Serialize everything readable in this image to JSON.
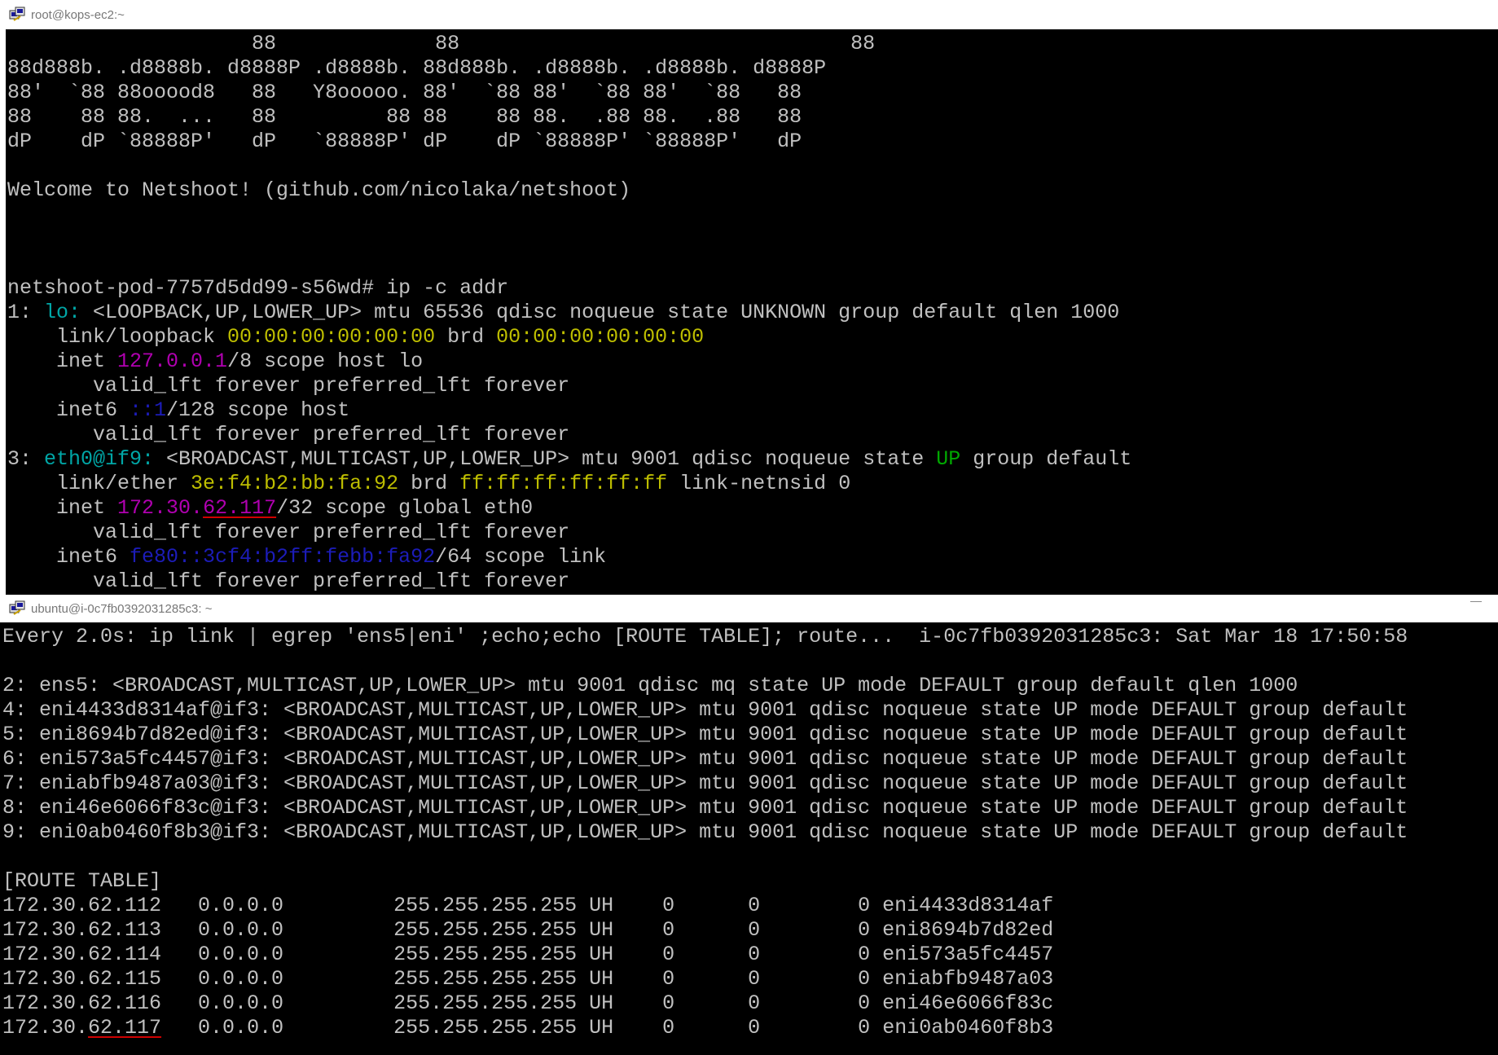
{
  "windows": {
    "top": {
      "title": "root@kops-ec2:~",
      "lines": [
        [
          {
            "t": "                    88             88                                88"
          }
        ],
        [
          {
            "t": "88d888b. .d8888b. d8888P .d8888b. 88d888b. .d8888b. .d8888b. d8888P"
          }
        ],
        [
          {
            "t": "88'  `88 88ooood8   88   Y8ooooo. 88'  `88 88'  `88 88'  `88   88"
          }
        ],
        [
          {
            "t": "88    88 88.  ...   88         88 88    88 88.  .88 88.  .88   88"
          }
        ],
        [
          {
            "t": "dP    dP `88888P'   dP   `88888P' dP    dP `88888P' `88888P'   dP"
          }
        ],
        [
          {
            "t": ""
          }
        ],
        [
          {
            "t": "Welcome to Netshoot! (github.com/nicolaka/netshoot)"
          }
        ],
        [
          {
            "t": ""
          }
        ],
        [
          {
            "t": ""
          }
        ],
        [
          {
            "t": ""
          }
        ],
        [
          {
            "t": "netshoot-pod-7757d5dd99-s56wd# ip -c addr"
          }
        ],
        [
          {
            "t": "1: "
          },
          {
            "t": "lo:",
            "c": "cyan"
          },
          {
            "t": " <LOOPBACK,UP,LOWER_UP> mtu 65536 qdisc noqueue state UNKNOWN group default qlen 1000"
          }
        ],
        [
          {
            "t": "    link/loopback "
          },
          {
            "t": "00:00:00:00:00:00",
            "c": "yellow"
          },
          {
            "t": " brd "
          },
          {
            "t": "00:00:00:00:00:00",
            "c": "yellow"
          }
        ],
        [
          {
            "t": "    inet "
          },
          {
            "t": "127.0.0.1",
            "c": "magenta"
          },
          {
            "t": "/8 scope host lo"
          }
        ],
        [
          {
            "t": "       valid_lft forever preferred_lft forever"
          }
        ],
        [
          {
            "t": "    inet6 "
          },
          {
            "t": "::1",
            "c": "blue"
          },
          {
            "t": "/128 scope host"
          }
        ],
        [
          {
            "t": "       valid_lft forever preferred_lft forever"
          }
        ],
        [
          {
            "t": "3: "
          },
          {
            "t": "eth0@if9:",
            "c": "cyan"
          },
          {
            "t": " <BROADCAST,MULTICAST,UP,LOWER_UP> mtu 9001 qdisc noqueue state "
          },
          {
            "t": "UP",
            "c": "green"
          },
          {
            "t": " group default"
          }
        ],
        [
          {
            "t": "    link/ether "
          },
          {
            "t": "3e:f4:b2:bb:fa:92",
            "c": "yellow"
          },
          {
            "t": " brd "
          },
          {
            "t": "ff:ff:ff:ff:ff:ff",
            "c": "yellow"
          },
          {
            "t": " link-netnsid 0"
          }
        ],
        [
          {
            "t": "    inet "
          },
          {
            "t": "172.30.",
            "c": "magenta"
          },
          {
            "t": "62.117",
            "c": "magenta",
            "u": true
          },
          {
            "t": "/32 scope global eth0"
          }
        ],
        [
          {
            "t": "       valid_lft forever preferred_lft forever"
          }
        ],
        [
          {
            "t": "    inet6 "
          },
          {
            "t": "fe80::3cf4:b2ff:febb:fa92",
            "c": "blue"
          },
          {
            "t": "/64 scope link"
          }
        ],
        [
          {
            "t": "       valid_lft forever preferred_lft forever"
          }
        ]
      ]
    },
    "bottom": {
      "title": "ubuntu@i-0c7fb0392031285c3: ~",
      "lines": [
        [
          {
            "t": "Every 2.0s: ip link | egrep 'ens5|eni' ;echo;echo [ROUTE TABLE]; route...  i-0c7fb0392031285c3: Sat Mar 18 17:50:58"
          }
        ],
        [
          {
            "t": ""
          }
        ],
        [
          {
            "t": "2: ens5: <BROADCAST,MULTICAST,UP,LOWER_UP> mtu 9001 qdisc mq state UP mode DEFAULT group default qlen 1000"
          }
        ],
        [
          {
            "t": "4: eni4433d8314af@if3: <BROADCAST,MULTICAST,UP,LOWER_UP> mtu 9001 qdisc noqueue state UP mode DEFAULT group default"
          }
        ],
        [
          {
            "t": "5: eni8694b7d82ed@if3: <BROADCAST,MULTICAST,UP,LOWER_UP> mtu 9001 qdisc noqueue state UP mode DEFAULT group default"
          }
        ],
        [
          {
            "t": "6: eni573a5fc4457@if3: <BROADCAST,MULTICAST,UP,LOWER_UP> mtu 9001 qdisc noqueue state UP mode DEFAULT group default"
          }
        ],
        [
          {
            "t": "7: eniabfb9487a03@if3: <BROADCAST,MULTICAST,UP,LOWER_UP> mtu 9001 qdisc noqueue state UP mode DEFAULT group default"
          }
        ],
        [
          {
            "t": "8: eni46e6066f83c@if3: <BROADCAST,MULTICAST,UP,LOWER_UP> mtu 9001 qdisc noqueue state UP mode DEFAULT group default"
          }
        ],
        [
          {
            "t": "9: eni0ab0460f8b3@if3: <BROADCAST,MULTICAST,UP,LOWER_UP> mtu 9001 qdisc noqueue state UP mode DEFAULT group default"
          }
        ],
        [
          {
            "t": ""
          }
        ],
        [
          {
            "t": "[ROUTE TABLE]"
          }
        ],
        [
          {
            "t": "172.30.62.112   0.0.0.0         255.255.255.255 UH    0      0        0 eni4433d8314af"
          }
        ],
        [
          {
            "t": "172.30.62.113   0.0.0.0         255.255.255.255 UH    0      0        0 eni8694b7d82ed"
          }
        ],
        [
          {
            "t": "172.30.62.114   0.0.0.0         255.255.255.255 UH    0      0        0 eni573a5fc4457"
          }
        ],
        [
          {
            "t": "172.30.62.115   0.0.0.0         255.255.255.255 UH    0      0        0 eniabfb9487a03"
          }
        ],
        [
          {
            "t": "172.30.62.116   0.0.0.0         255.255.255.255 UH    0      0        0 eni46e6066f83c"
          }
        ],
        [
          {
            "t": "172.30."
          },
          {
            "t": "62.117",
            "u": true
          },
          {
            "t": "   0.0.0.0         255.255.255.255 UH    0      0        0 eni0ab0460f8b3"
          }
        ]
      ]
    }
  }
}
